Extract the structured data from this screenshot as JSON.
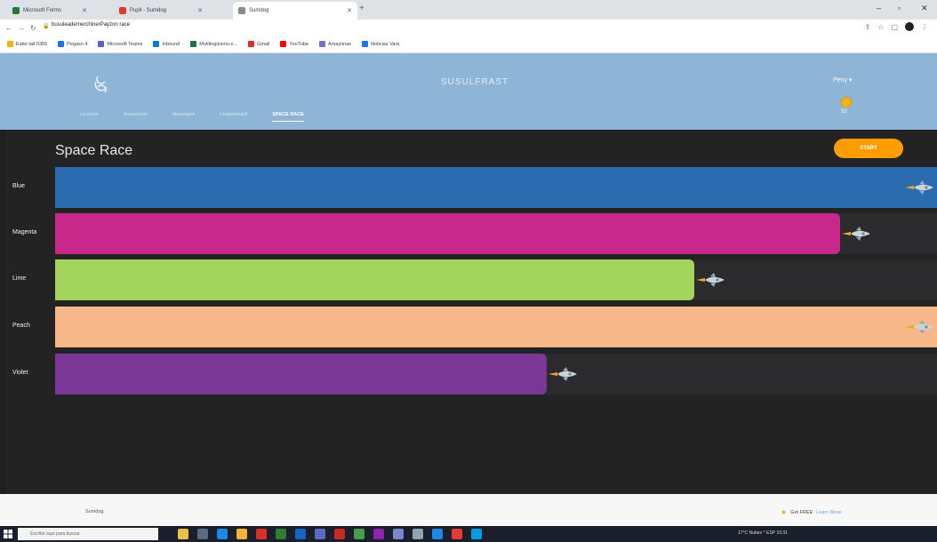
{
  "browser": {
    "tabs": [
      {
        "label": "Microsoft Forms",
        "color": "#1b7b3b",
        "active": false
      },
      {
        "label": "Pupil - Sumdog",
        "color": "#e23b2e",
        "active": false
      },
      {
        "label": "Sumdog",
        "color": "#8a8a8a",
        "active": true
      }
    ],
    "url": "busuleadernerchinerPayzon race",
    "bookmarks": [
      {
        "label": "Eatto tail 0355",
        "color": "#f4b400"
      },
      {
        "label": "Pegaso 4",
        "color": "#1a73e8"
      },
      {
        "label": "Microsoft Teams",
        "color": "#5b5fc7"
      },
      {
        "label": "Inbound",
        "color": "#0078d4"
      },
      {
        "label": "Mutilingüismo e...",
        "color": "#217346"
      },
      {
        "label": "Gmail",
        "color": "#d93025"
      },
      {
        "label": "YouTube",
        "color": "#ff0000"
      },
      {
        "label": "Amazonas",
        "color": "#7b6fd6"
      },
      {
        "label": "Noticias Vara",
        "color": "#1a73e8"
      }
    ]
  },
  "header": {
    "brand": "SUSULFRAST",
    "user_menu": "Peny ▾",
    "nav": [
      {
        "label": "Lessons",
        "active": false
      },
      {
        "label": "Sequences",
        "active": false
      },
      {
        "label": "Messages",
        "active": false
      },
      {
        "label": "Leaderboard",
        "active": false
      },
      {
        "label": "SPACE RACE",
        "active": true
      }
    ],
    "coin_count": "32"
  },
  "race": {
    "title": "Space Race",
    "start_label": "START",
    "lanes": [
      {
        "label": "Blue",
        "color": "#2b6cb0",
        "progress": 1.0
      },
      {
        "label": "Magenta",
        "color": "#c8288a",
        "progress": 0.89
      },
      {
        "label": "Lime",
        "color": "#a3d45e",
        "progress": 0.725
      },
      {
        "label": "Peach",
        "color": "#f7b98a",
        "progress": 1.0
      },
      {
        "label": "Violet",
        "color": "#7b3796",
        "progress": 0.557
      }
    ]
  },
  "footer": {
    "left": "Sumdog",
    "right_text": "Get FREE",
    "right_link": "Learn More"
  },
  "taskbar": {
    "search_placeholder": "Escribe aquí para buscar",
    "tray_text": "17°C Nubes  ^  ESP  10:31"
  }
}
